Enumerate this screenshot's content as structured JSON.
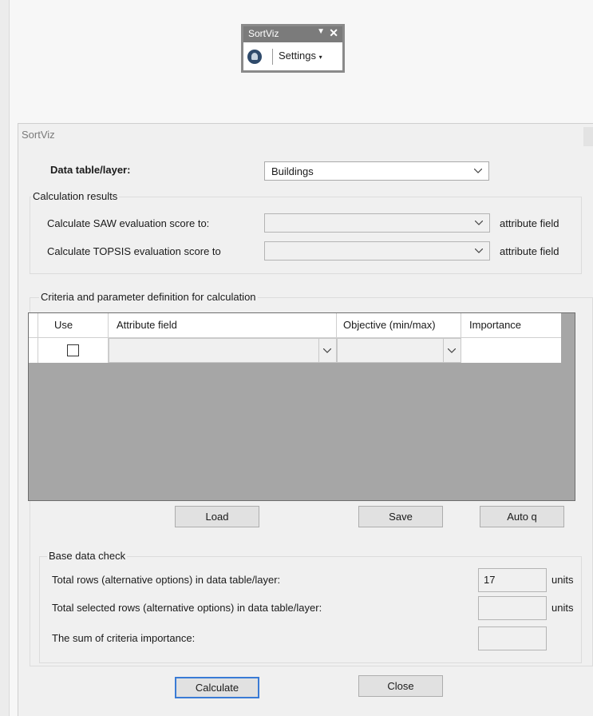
{
  "toolbar": {
    "title": "SortViz",
    "menu_dropdown": "▼",
    "close": "✕",
    "settings_label": "Settings",
    "settings_caret": "▾"
  },
  "dialog": {
    "title": "SortViz",
    "data_table_label": "Data table/layer:",
    "data_table_value": "Buildings",
    "calc_results": {
      "group_label": "Calculation results",
      "saw_label": "Calculate SAW evaluation score to:",
      "saw_value": "",
      "saw_suffix": "attribute field",
      "topsis_label": "Calculate TOPSIS evaluation score to",
      "topsis_value": "",
      "topsis_suffix": "attribute field"
    },
    "criteria": {
      "group_label": "Criteria and parameter definition for calculation",
      "columns": [
        "Use",
        "Attribute field",
        "Objective (min/max)",
        "Importance"
      ],
      "rows": [
        {
          "use": false,
          "attribute_field": "",
          "objective": "",
          "importance": ""
        }
      ]
    },
    "buttons": {
      "load": "Load",
      "save": "Save",
      "auto": "Auto q",
      "calculate": "Calculate",
      "close": "Close"
    },
    "base_data": {
      "group_label": "Base data check",
      "total_rows_label": "Total rows (alternative options) in data table/layer:",
      "total_rows_value": "17",
      "total_rows_unit": "units",
      "selected_rows_label": "Total selected rows (alternative options) in data table/layer:",
      "selected_rows_value": "",
      "selected_rows_unit": "units",
      "importance_sum_label": "The sum of criteria importance:",
      "importance_sum_value": ""
    }
  }
}
